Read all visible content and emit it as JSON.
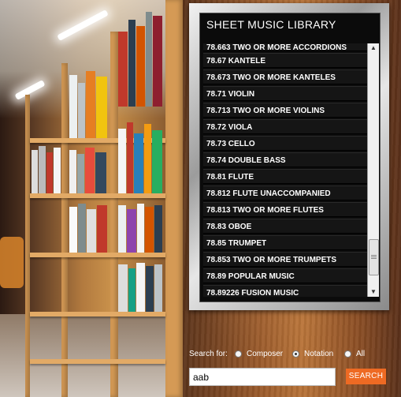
{
  "library": {
    "title": "SHEET MUSIC LIBRARY",
    "items": [
      "78.663 TWO OR MORE ACCORDIONS",
      "78.67 KANTELE",
      "78.673 TWO OR MORE KANTELES",
      "78.71 VIOLIN",
      "78.713 TWO OR MORE VIOLINS",
      "78.72 VIOLA",
      "78.73 CELLO",
      "78.74 DOUBLE BASS",
      "78.81 FLUTE",
      "78.812 FLUTE UNACCOMPANIED",
      "78.813 TWO OR MORE FLUTES",
      "78.83 OBOE",
      "78.85 TRUMPET",
      "78.853 TWO OR MORE TRUMPETS",
      "78.89 POPULAR MUSIC",
      "78.89226 FUSION MUSIC"
    ]
  },
  "search": {
    "label": "Search for:",
    "options": [
      {
        "label": "Composer",
        "selected": false
      },
      {
        "label": "Notation",
        "selected": true
      },
      {
        "label": "All",
        "selected": false
      }
    ],
    "value": "aab",
    "button": "SEARCH"
  },
  "icons": {
    "scroll_up": "up-arrow-icon",
    "scroll_down": "down-arrow-icon"
  },
  "colors": {
    "accent": "#ee6a23",
    "list_bg": "#0b0b0b"
  }
}
